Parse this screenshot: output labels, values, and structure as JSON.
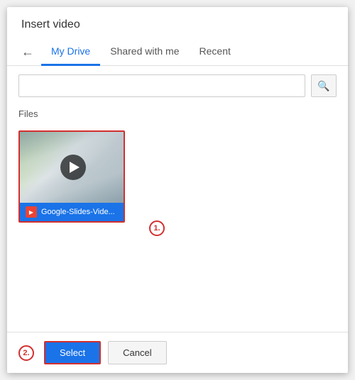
{
  "dialog": {
    "title": "Insert video",
    "back_label": "←",
    "tabs": [
      {
        "id": "my-drive",
        "label": "My Drive",
        "active": true
      },
      {
        "id": "shared-with-me",
        "label": "Shared with me",
        "active": false
      },
      {
        "id": "recent",
        "label": "Recent",
        "active": false
      }
    ],
    "search": {
      "placeholder": "",
      "search_icon": "🔍"
    },
    "files_label": "Files",
    "video_item": {
      "name": "Google-Slides-Vide...",
      "play_icon": "▶"
    },
    "annotation_1": "1.",
    "annotation_2": "2.",
    "footer": {
      "select_label": "Select",
      "cancel_label": "Cancel"
    }
  }
}
